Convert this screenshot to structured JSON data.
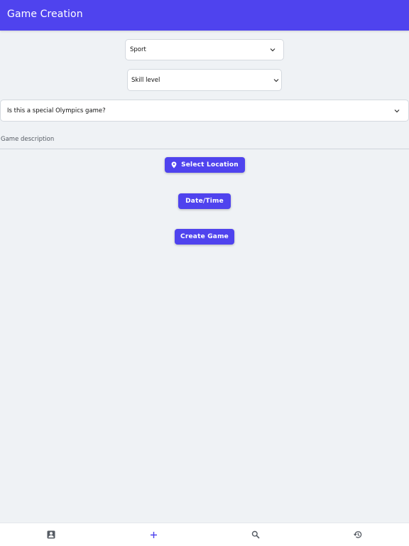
{
  "header": {
    "title": "Game Creation"
  },
  "form": {
    "sport_label": "Sport",
    "skill_label": "Skill level",
    "olympics_label": "Is this a special Olympics game?",
    "description_label": "Game description"
  },
  "buttons": {
    "select_location": "Select Location",
    "date_time": "Date/Time",
    "create_game": "Create Game"
  },
  "bottom_nav": {
    "items": [
      {
        "icon": "profile-icon",
        "active": false
      },
      {
        "icon": "add-icon",
        "active": true
      },
      {
        "icon": "search-icon",
        "active": false
      },
      {
        "icon": "history-icon",
        "active": false
      }
    ]
  },
  "colors": {
    "accent": "#4f43ee",
    "background": "#eff2f5",
    "nav_icon": "#555b63"
  }
}
